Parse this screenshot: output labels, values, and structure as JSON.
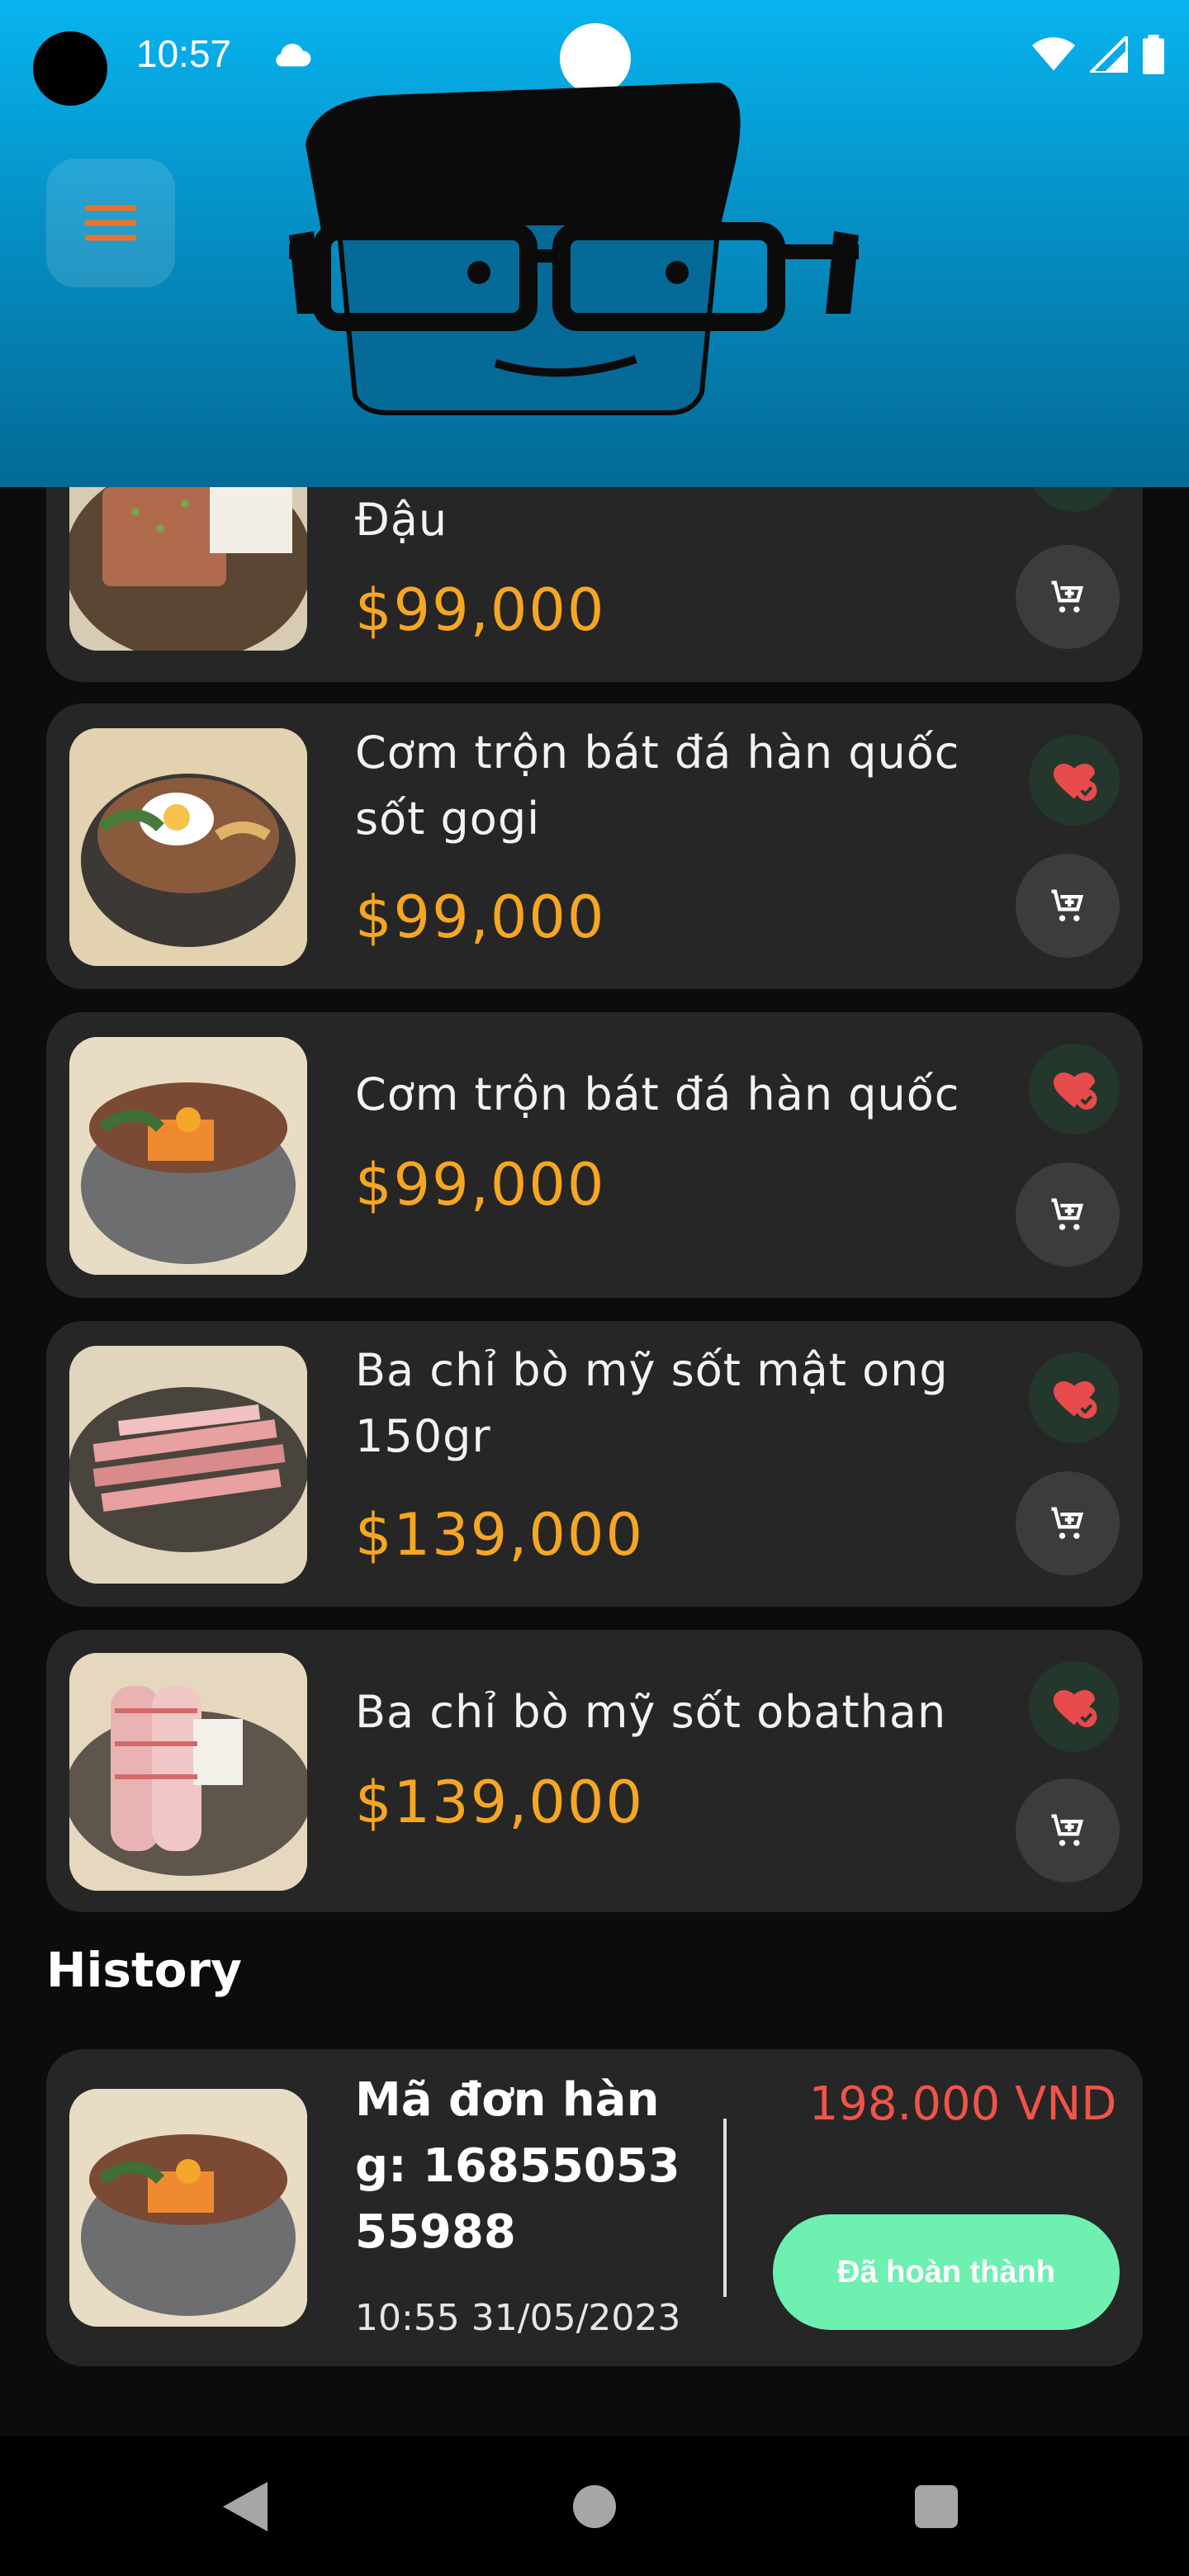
{
  "status_bar": {
    "time": "10:57",
    "icons": [
      "cloud-icon",
      "wifi-icon",
      "signal-icon",
      "battery-icon"
    ]
  },
  "header": {
    "menu_icon": "hamburger-icon",
    "avatar": "cartoon-face-glasses-icon"
  },
  "products": [
    {
      "name": "Đậu",
      "price": "$99,000"
    },
    {
      "name": "Cơm trộn bát đá hàn quốc sốt gogi",
      "price": "$99,000"
    },
    {
      "name": "Cơm trộn bát đá hàn quốc",
      "price": "$99,000"
    },
    {
      "name": "Ba chỉ bò mỹ sốt mật ong 150gr",
      "price": "$139,000"
    },
    {
      "name": "Ba chỉ bò mỹ sốt obathan",
      "price": "$139,000"
    }
  ],
  "history": {
    "title": "History",
    "orders": [
      {
        "label": "Mã đơn hàng: 1685505355988",
        "time": "10:55 31/05/2023",
        "amount": "198.000 VND",
        "status": "Đã hoàn thành"
      }
    ]
  },
  "colors": {
    "price": "#f5a623",
    "amount": "#f0544a",
    "status_button": "#6ef0b0",
    "favorite": "#e84b4b",
    "card": "#262626"
  },
  "nav": {
    "icons": [
      "back-icon",
      "home-icon",
      "recents-icon"
    ]
  }
}
